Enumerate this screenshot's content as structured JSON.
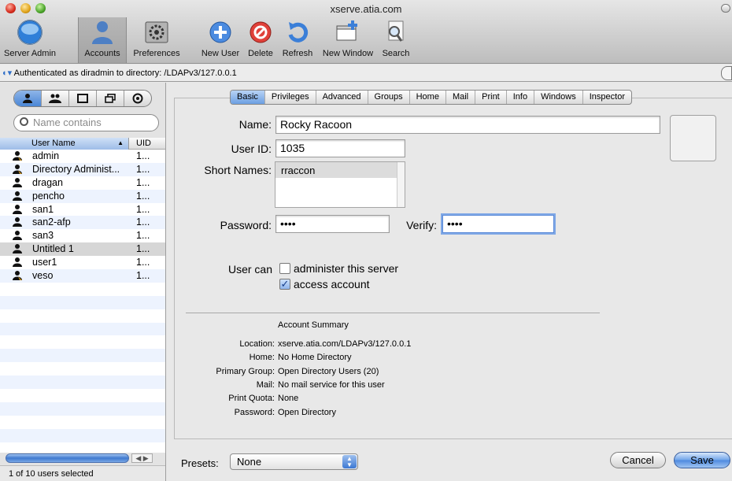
{
  "window": {
    "title": "xserve.atia.com"
  },
  "toolbar": [
    {
      "id": "server-admin",
      "label": "Server Admin"
    },
    {
      "id": "accounts",
      "label": "Accounts"
    },
    {
      "id": "preferences",
      "label": "Preferences"
    },
    {
      "id": "new-user",
      "label": "New User"
    },
    {
      "id": "delete",
      "label": "Delete"
    },
    {
      "id": "refresh",
      "label": "Refresh"
    },
    {
      "id": "new-window",
      "label": "New Window"
    },
    {
      "id": "search",
      "label": "Search"
    }
  ],
  "auth": {
    "text": "Authenticated as diradmin to directory: /LDAPv3/127.0.0.1"
  },
  "sidebar": {
    "search_placeholder": "Name contains",
    "columns": {
      "name": "User Name",
      "uid": "UID"
    },
    "users": [
      {
        "name": "admin",
        "uid": "1...",
        "icon": "admin-user-icon"
      },
      {
        "name": "Directory Administ...",
        "uid": "1...",
        "icon": "admin-user-icon"
      },
      {
        "name": "dragan",
        "uid": "1...",
        "icon": "user-icon"
      },
      {
        "name": "pencho",
        "uid": "1...",
        "icon": "user-icon"
      },
      {
        "name": "san1",
        "uid": "1...",
        "icon": "user-icon"
      },
      {
        "name": "san2-afp",
        "uid": "1...",
        "icon": "user-icon"
      },
      {
        "name": "san3",
        "uid": "1...",
        "icon": "user-icon"
      },
      {
        "name": "Untitled 1",
        "uid": "1...",
        "icon": "user-icon",
        "selected": true
      },
      {
        "name": "user1",
        "uid": "1...",
        "icon": "user-icon"
      },
      {
        "name": "veso",
        "uid": "1...",
        "icon": "admin-user-icon"
      }
    ],
    "status": "1 of 10 users selected"
  },
  "tabs": [
    "Basic",
    "Privileges",
    "Advanced",
    "Groups",
    "Home",
    "Mail",
    "Print",
    "Info",
    "Windows",
    "Inspector"
  ],
  "active_tab": "Basic",
  "form": {
    "name_label": "Name:",
    "name_value": "Rocky Racoon",
    "uid_label": "User ID:",
    "uid_value": "1035",
    "short_names_label": "Short Names:",
    "short_names": [
      "rraccon"
    ],
    "password_label": "Password:",
    "password_value": "••••",
    "verify_label": "Verify:",
    "verify_value": "••••",
    "user_can_label": "User can",
    "administer_label": "administer this server",
    "administer_checked": false,
    "access_label": "access account",
    "access_checked": true
  },
  "summary": {
    "title": "Account Summary",
    "rows": [
      {
        "key": "Location:",
        "value": "xserve.atia.com/LDAPv3/127.0.0.1"
      },
      {
        "key": "Home:",
        "value": "No Home Directory"
      },
      {
        "key": "Primary Group:",
        "value": "Open Directory Users (20)"
      },
      {
        "key": "Mail:",
        "value": "No mail service for this user"
      },
      {
        "key": "Print Quota:",
        "value": "None"
      },
      {
        "key": "Password:",
        "value": "Open Directory"
      }
    ]
  },
  "footer": {
    "presets_label": "Presets:",
    "presets_value": "None",
    "cancel_label": "Cancel",
    "save_label": "Save"
  }
}
